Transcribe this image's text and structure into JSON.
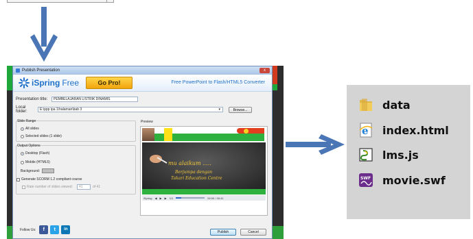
{
  "dialog": {
    "title": "Publish Presentation",
    "close_label": "x",
    "brand": "iSpring",
    "brand_suffix": "Free",
    "gopro_label": "Go Pro!",
    "tagline": "Free PowerPoint to Flash/HTML5 Converter",
    "presentation_title_label": "Presentation title:",
    "presentation_title_value": "PEMBELAJARAN LISTRIK DINAMIS",
    "local_folder_label": "Local folder:",
    "local_folder_value": "E:\\ppp ipa 1\\halaman\\bab 3",
    "browse_label": "Browse...",
    "slide_range": {
      "title": "Slide Range",
      "all_slides": "All slides",
      "selected_slides": "Selected slides (1 slide)"
    },
    "output_options": {
      "title": "Output Options",
      "desktop": "Desktop (Flash)",
      "mobile": "Mobile (HTML5)",
      "background_label": "Background:",
      "scorm_label": "Generate SCORM 1.2 compliant course",
      "rate_label": "Rate number of slides viewed:",
      "rate_value": "41",
      "rate_of": "of 41"
    },
    "preview": {
      "title": "Preview",
      "line1": "mu alaikum .....",
      "line2": "Berjumpa dengan",
      "line3": "Takari Education Centre",
      "player_label": "iSpring",
      "slide_counter": "1/1",
      "time": "00:00 / 00:41"
    },
    "follow_label": "Follow Us:",
    "social": [
      "f",
      "t",
      "in"
    ],
    "publish_label": "Publish",
    "cancel_label": "Cancel"
  },
  "files": [
    {
      "name": "data",
      "icon": "folder-icon"
    },
    {
      "name": "index.html",
      "icon": "ie-html-icon"
    },
    {
      "name": "lms.js",
      "icon": "js-script-icon"
    },
    {
      "name": "movie.swf",
      "icon": "swf-icon"
    }
  ],
  "colors": {
    "arrow": "#4a76b5",
    "brand_blue": "#1e6fc9",
    "gopro": "#f2a40c",
    "facebook": "#3b5998",
    "twitter": "#2aa3e8",
    "linkedin": "#0b78b5"
  }
}
